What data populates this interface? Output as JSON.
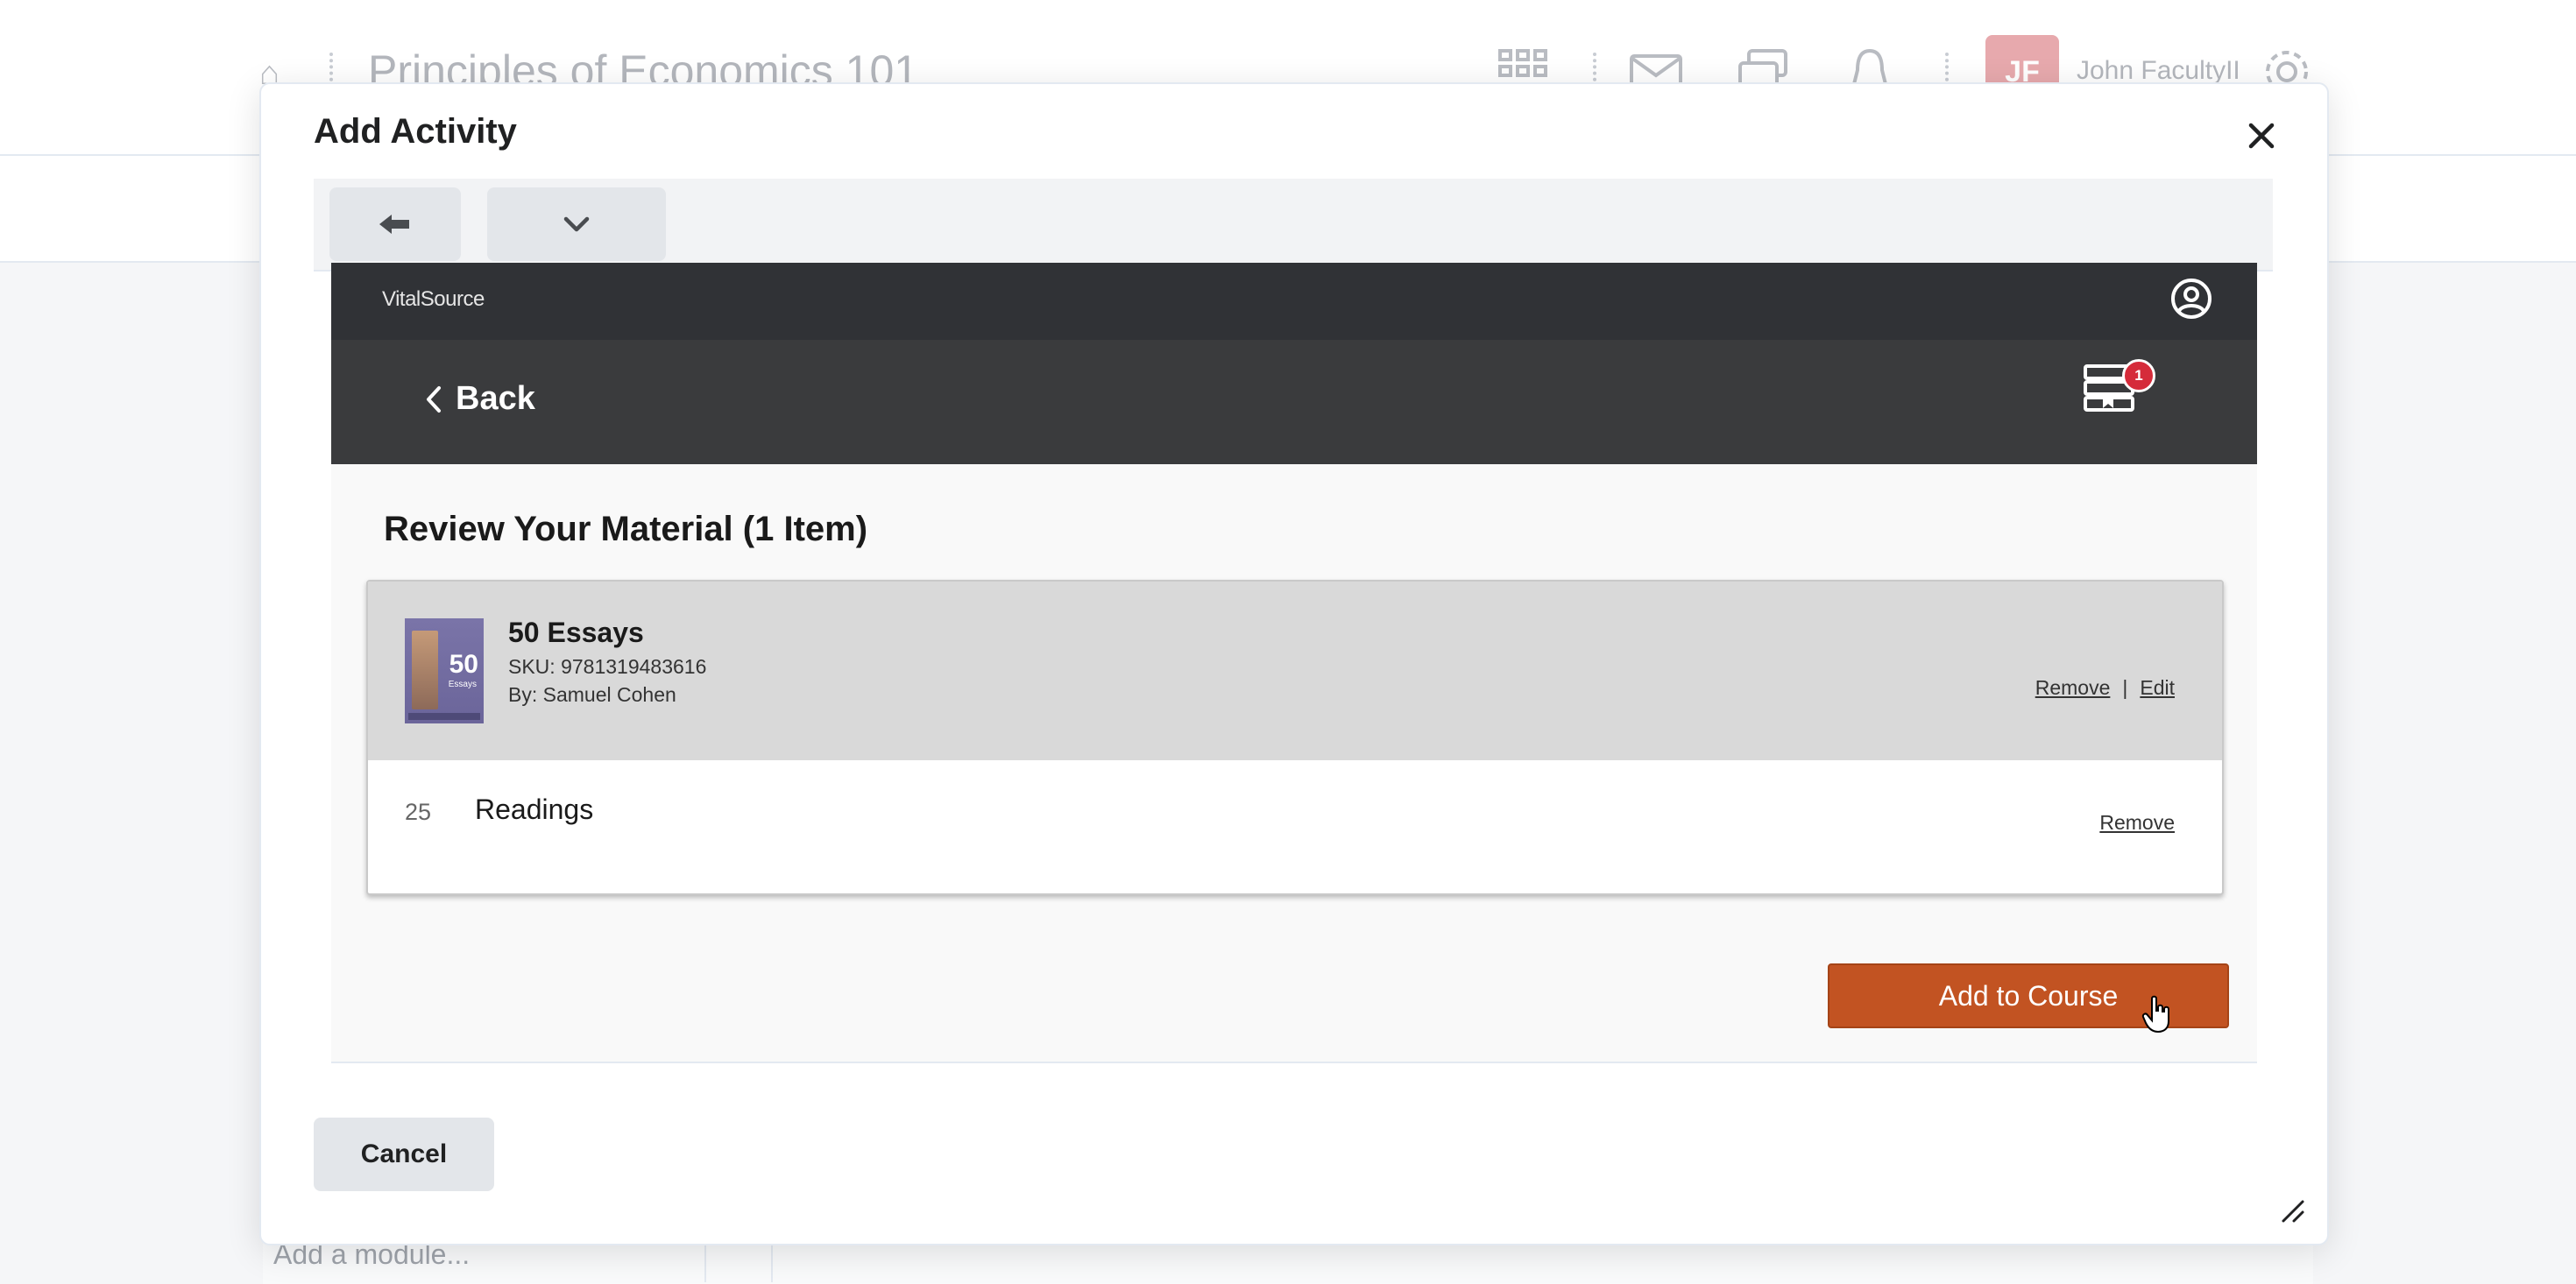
{
  "background": {
    "course_title": "Principles of Economics 101",
    "avatar_initials": "JF",
    "user_name": "John FacultyII",
    "add_module_placeholder": "Add a module..."
  },
  "modal": {
    "title": "Add Activity",
    "close_label": "✕",
    "cancel_label": "Cancel"
  },
  "vitalsource": {
    "logo_text": "VitalSource",
    "back_label": "Back",
    "cart_count": "1",
    "review_heading": "Review Your Material (1 Item)",
    "items": [
      {
        "title": "50 Essays",
        "sku": "SKU: 9781319483616",
        "author": "By: Samuel Cohen",
        "cover_number": "50",
        "cover_word": "Essays",
        "remove_label": "Remove",
        "separator": "|",
        "edit_label": "Edit",
        "sub_rows": [
          {
            "count": "25",
            "label": "Readings",
            "remove_label": "Remove"
          }
        ]
      }
    ],
    "add_to_course_label": "Add to Course"
  },
  "colors": {
    "accent_button": "#c25322",
    "vs_header": "#303236",
    "vs_nav": "#3a3b3d",
    "cart_badge": "#d52b3a"
  }
}
